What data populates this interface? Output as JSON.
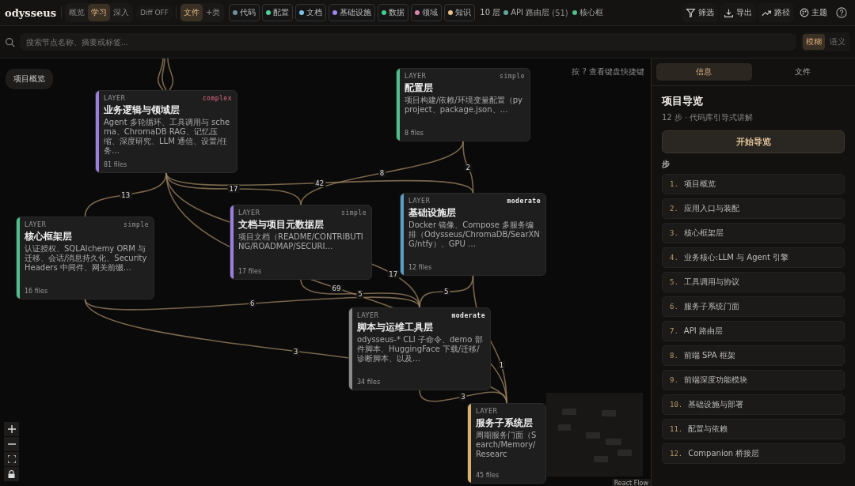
{
  "app": {
    "logo": "odysseus"
  },
  "modes": [
    {
      "label": "概览",
      "selected": false
    },
    {
      "label": "学习",
      "selected": true
    },
    {
      "label": "深入",
      "selected": false
    }
  ],
  "diff": {
    "label": "Diff OFF"
  },
  "granularity": [
    {
      "label": "文件",
      "selected": true
    },
    {
      "label": "+类",
      "selected": false
    }
  ],
  "legend": [
    {
      "label": "代码",
      "color": "#6f8f9c"
    },
    {
      "label": "配置",
      "color": "#4fd39a"
    },
    {
      "label": "文档",
      "color": "#7cc4e8"
    },
    {
      "label": "基础设施",
      "color": "#9b87e8"
    },
    {
      "label": "数据",
      "color": "#3fcf8e"
    },
    {
      "label": "领域",
      "color": "#d987a8"
    },
    {
      "label": "知识",
      "color": "#e8c08a"
    }
  ],
  "layer_count": "10 层",
  "layer_tags": [
    {
      "label": "API 路由层",
      "count": "(51)",
      "color": "#5fa8a0"
    },
    {
      "label": "核心框",
      "color": "#4fbf8a"
    }
  ],
  "actions": [
    {
      "kind": "filter",
      "label": "筛选"
    },
    {
      "kind": "export",
      "label": "导出"
    },
    {
      "kind": "path",
      "label": "路径"
    },
    {
      "kind": "theme",
      "label": "主题"
    },
    {
      "kind": "help"
    }
  ],
  "search": {
    "placeholder": "搜索节点名称、摘要或标签..."
  },
  "search_modes": [
    {
      "label": "模糊",
      "selected": true
    },
    {
      "label": "语义",
      "selected": false
    }
  ],
  "canvas": {
    "overview_button": "项目概览",
    "hint": "按 ? 查看键盘快捷键",
    "attribution": "React Flow",
    "nodes": [
      {
        "tag": "LAYER",
        "complexity": "complex",
        "title": "业务逻辑与领域层",
        "summary": "Agent 多轮循环、工具调用与 schema、ChromaDB RAG、记忆压缩、深度研究、LLM 通信、设置/任务…",
        "files": "81 files",
        "color": "#9b7fe0"
      },
      {
        "tag": "LAYER",
        "complexity": "simple",
        "title": "配置层",
        "summary": "项目构建/依赖/环境变量配置（pyproject、package.json、…",
        "files": "8 files",
        "color": "#4fbf8a"
      },
      {
        "tag": "LAYER",
        "complexity": "simple",
        "title": "核心框架层",
        "summary": "认证授权、SQLAlchemy ORM 与迁移、会话/消息持久化、SecurityHeaders 中间件、网关前缀…",
        "files": "16 files",
        "color": "#4fbf8a"
      },
      {
        "tag": "LAYER",
        "complexity": "simple",
        "title": "文档与项目元数据层",
        "summary": "项目文档（README/CONTRIBUTING/ROADMAP/SECURI…",
        "files": "17 files",
        "color": "#9b7fe0"
      },
      {
        "tag": "LAYER",
        "complexity": "moderate",
        "title": "基础设施层",
        "summary": "Docker 镜像、Compose 多服务编排（Odysseus/ChromaDB/SearXNG/ntfy）、GPU …",
        "files": "12 files",
        "color": "#5a9ec8"
      },
      {
        "tag": "LAYER",
        "complexity": "moderate",
        "title": "脚本与运维工具层",
        "summary": "odysseus-* CLI 子命令、demo 部件脚本、HuggingFace 下载/迁移/诊断脚本、以及…",
        "files": "34 files",
        "color": "#8a8a8a"
      },
      {
        "tag": "LAYER",
        "title": "服务子系统层",
        "summary": "周期服务门面（Search/Memory/Researc",
        "files": "45 files",
        "color": "#d9b070"
      }
    ],
    "edges": [
      {
        "label": "13"
      },
      {
        "label": "17"
      },
      {
        "label": "42"
      },
      {
        "label": "8"
      },
      {
        "label": "2"
      },
      {
        "label": "6"
      },
      {
        "label": "3"
      },
      {
        "label": "17"
      },
      {
        "label": "69"
      },
      {
        "label": "5"
      },
      {
        "label": "5"
      },
      {
        "label": "1"
      },
      {
        "label": "3"
      }
    ]
  },
  "panel": {
    "tabs": [
      {
        "label": "信息",
        "selected": true
      },
      {
        "label": "文件",
        "selected": false
      }
    ],
    "title": "项目导览",
    "subtitle": "12 步 · 代码库引导式讲解",
    "start_button": "开始导览",
    "steps_label": "步",
    "steps": [
      {
        "number": "1.",
        "label": "项目概览"
      },
      {
        "number": "2.",
        "label": "应用入口与装配"
      },
      {
        "number": "3.",
        "label": "核心框架层"
      },
      {
        "number": "4.",
        "label": "业务核心:LLM 与 Agent 引擎"
      },
      {
        "number": "5.",
        "label": "工具调用与协议"
      },
      {
        "number": "6.",
        "label": "服务子系统门面"
      },
      {
        "number": "7.",
        "label": "API 路由层"
      },
      {
        "number": "8.",
        "label": "前端 SPA 框架"
      },
      {
        "number": "9.",
        "label": "前端深度功能模块"
      },
      {
        "number": "10.",
        "label": "基础设施与部署"
      },
      {
        "number": "11.",
        "label": "配置与依赖"
      },
      {
        "number": "12.",
        "label": "Companion 桥接层"
      }
    ]
  }
}
